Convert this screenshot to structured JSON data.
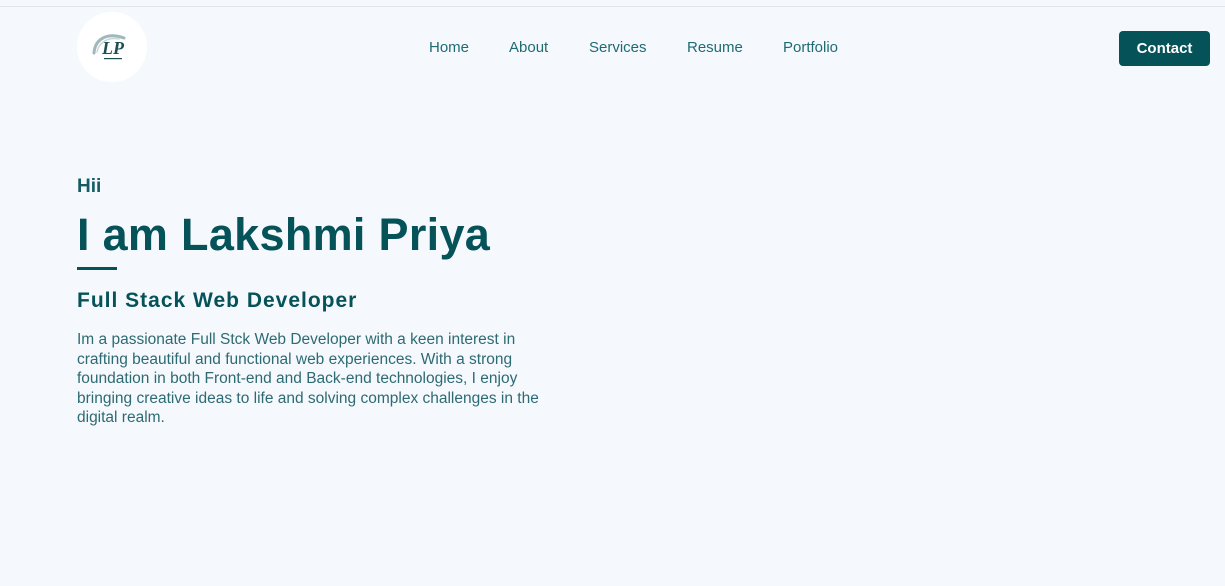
{
  "header": {
    "logo_text": "LP",
    "nav": [
      "Home",
      "About",
      "Services",
      "Resume",
      "Portfolio"
    ],
    "contact_label": "Contact"
  },
  "hero": {
    "greeting": "Hii",
    "name": "I am Lakshmi Priya",
    "role": "Full Stack Web Developer",
    "bio": "Im a passionate Full Stck Web Developer with a keen interest in crafting beautiful and functional web experiences. With a strong foundation in both Front-end and Back-end technologies, I enjoy bringing creative ideas to life and solving complex challenges in the digital realm."
  },
  "colors": {
    "background": "#f5f9fd",
    "primary": "#055259",
    "nav_text": "#1f6b72",
    "body_text": "#2d6a72"
  }
}
